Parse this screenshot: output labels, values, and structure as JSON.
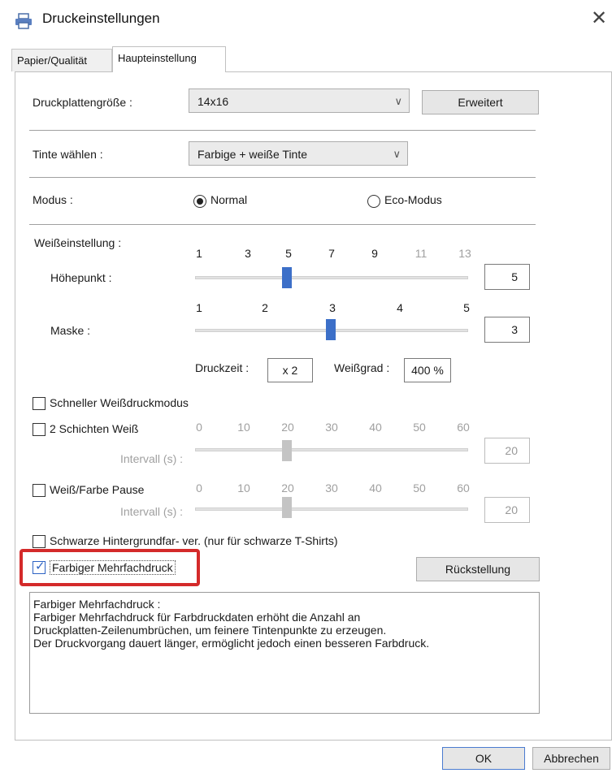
{
  "window": {
    "title": "Druckeinstellungen",
    "icon": "printer-icon",
    "close_glyph": "✕"
  },
  "tabs": [
    {
      "label": "Papier/Qualität",
      "active": false
    },
    {
      "label": "Haupteinstellung",
      "active": true
    }
  ],
  "platen": {
    "label": "Druckplattengröße :",
    "value": "14x16",
    "advanced_button": "Erweitert"
  },
  "ink": {
    "label": "Tinte wählen :",
    "value": "Farbige + weiße Tinte"
  },
  "mode": {
    "label": "Modus :",
    "options": [
      "Normal",
      "Eco-Modus"
    ],
    "selected": "Normal"
  },
  "white_setting": {
    "label": "Weißeinstellung :",
    "highlight": {
      "label": "Höhepunkt :",
      "ticks": [
        "1",
        "3",
        "5",
        "7",
        "9",
        "11",
        "13"
      ],
      "ticks_dim": [
        false,
        false,
        false,
        false,
        false,
        true,
        true
      ],
      "value": "5"
    },
    "mask": {
      "label": "Maske :",
      "ticks": [
        "1",
        "2",
        "3",
        "4",
        "5"
      ],
      "value": "3"
    },
    "print_time": {
      "label": "Druckzeit :",
      "value": "x 2"
    },
    "white_degree": {
      "label": "Weißgrad :",
      "value": "400 %"
    }
  },
  "fast_white": {
    "label": "Schneller Weißdruckmodus",
    "checked": false
  },
  "two_layer": {
    "label": "2 Schichten Weiß",
    "checked": false,
    "ticks": [
      "0",
      "10",
      "20",
      "30",
      "40",
      "50",
      "60"
    ],
    "interval_label": "Intervall (s) :",
    "value": "20"
  },
  "white_color_pause": {
    "label": "Weiß/Farbe Pause",
    "checked": false,
    "ticks": [
      "0",
      "10",
      "20",
      "30",
      "40",
      "50",
      "60"
    ],
    "interval_label": "Intervall (s) :",
    "value": "20"
  },
  "black_bg": {
    "label": "Schwarze Hintergrundfar- ver. (nur für schwarze T-Shirts)",
    "checked": false
  },
  "multi_color": {
    "label": "Farbiger Mehrfachdruck",
    "checked": true
  },
  "reset_button": "Rückstellung",
  "description": [
    "Farbiger Mehrfachdruck :",
    "Farbiger Mehrfachdruck für Farbdruckdaten erhöht die Anzahl an",
    "Druckplatten-Zeilenumbrüchen, um feinere Tintenpunkte zu erzeugen.",
    "Der Druckvorgang dauert länger, ermöglicht jedoch einen besseren Farbdruck."
  ],
  "footer": {
    "ok": "OK",
    "cancel": "Abbrechen"
  },
  "colors": {
    "accent": "#3c6fc8",
    "highlight_box": "#d42a2a",
    "disabled_text": "#a0a0a0"
  }
}
